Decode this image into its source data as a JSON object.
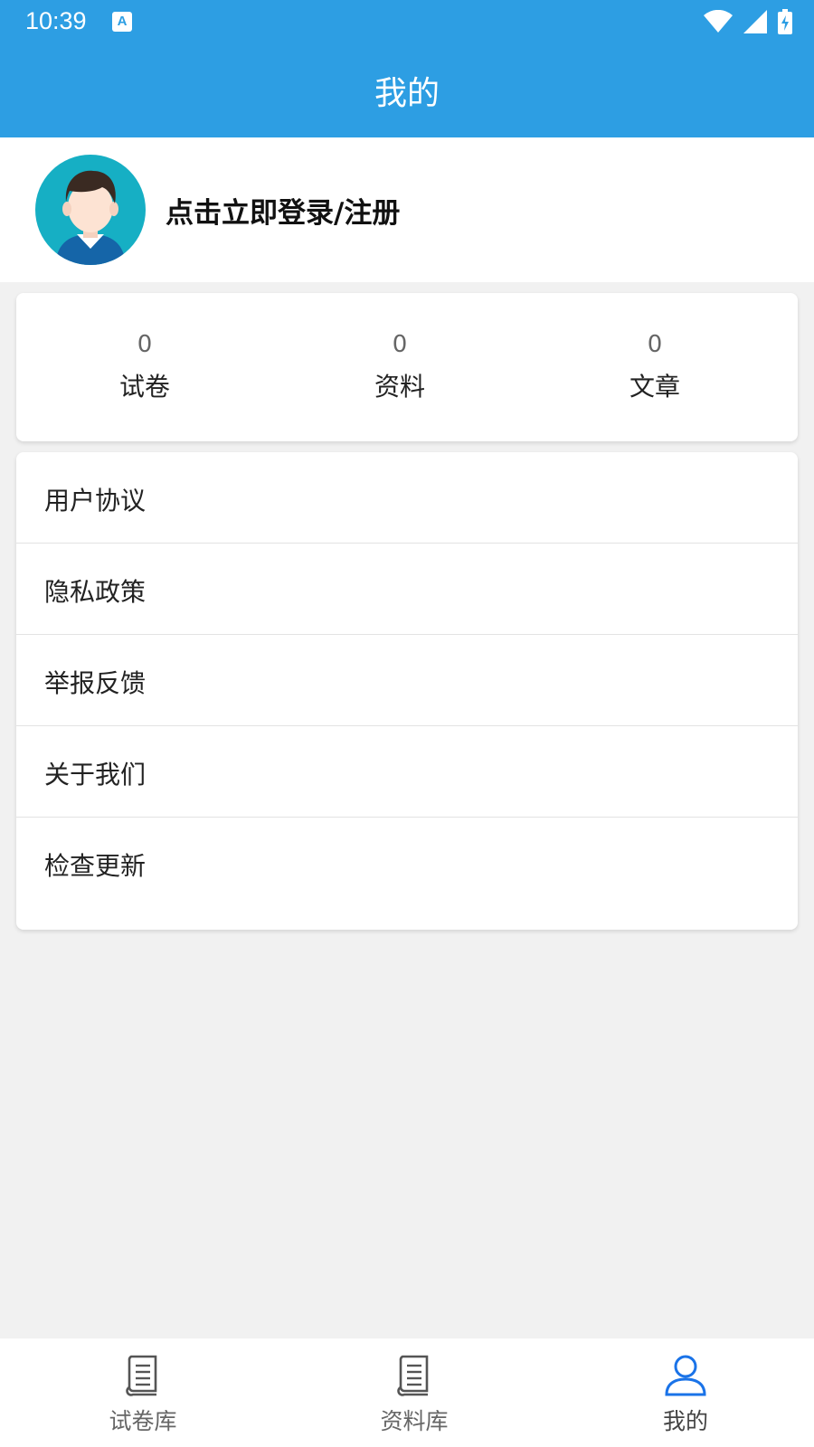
{
  "status_bar": {
    "time": "10:39",
    "notification_icon": "A",
    "icons": [
      "wifi-icon",
      "signal-icon",
      "battery-charging-icon"
    ]
  },
  "header": {
    "title": "我的"
  },
  "profile": {
    "login_text": "点击立即登录/注册",
    "avatar": "avatar-illustration"
  },
  "stats": [
    {
      "value": "0",
      "label": "试卷"
    },
    {
      "value": "0",
      "label": "资料"
    },
    {
      "value": "0",
      "label": "文章"
    }
  ],
  "menu": [
    {
      "label": "用户协议"
    },
    {
      "label": "隐私政策"
    },
    {
      "label": "举报反馈"
    },
    {
      "label": "关于我们"
    },
    {
      "label": "检查更新"
    }
  ],
  "bottom_nav": [
    {
      "label": "试卷库",
      "icon": "book-icon",
      "active": false
    },
    {
      "label": "资料库",
      "icon": "book-icon",
      "active": false
    },
    {
      "label": "我的",
      "icon": "user-icon",
      "active": true
    }
  ],
  "colors": {
    "primary": "#2d9ee3",
    "active_icon": "#1a73e8",
    "background": "#f1f1f1"
  }
}
